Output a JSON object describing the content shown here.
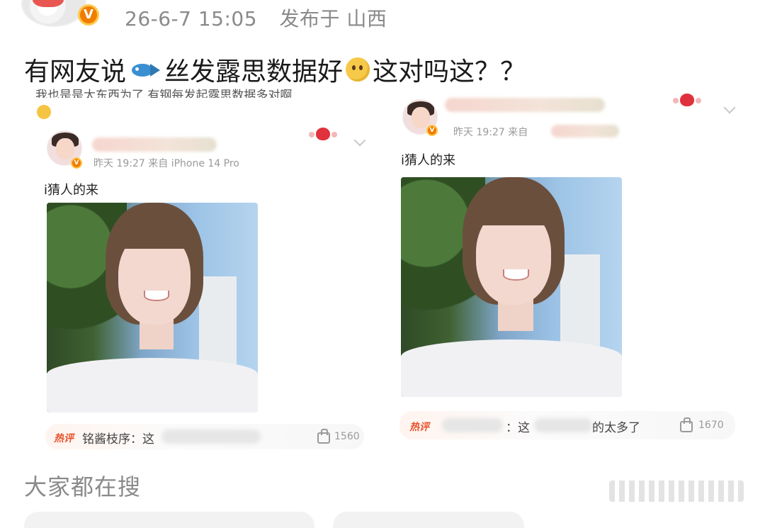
{
  "header": {
    "date": "26-6-7 15:05",
    "location": "发布于 山西",
    "verified_badge": "V"
  },
  "post": {
    "text_part1": "有网友说",
    "emoji1": "fish-icon",
    "text_part2": "丝发露思数据好",
    "emoji2": "thinking-face-icon",
    "text_part3": "这对吗这？？"
  },
  "screenshot_left": {
    "cut_text": "我也是是太东西为了 有钢每发起露思数据多对啊",
    "meta": "昨天 19:27  来自 iPhone 14 Pro",
    "content": "i猜人的来",
    "hot_label": "热评",
    "hot_text": "铭酱枝序：这",
    "likes": "1560"
  },
  "screenshot_right": {
    "meta": "昨天 19:27  来自",
    "content": "i猜人的来",
    "hot_label": "热评",
    "hot_text_prefix": "：这",
    "hot_text_suffix": "的太多了",
    "likes": "1670"
  },
  "section": {
    "title": "大家都在搜"
  },
  "colors": {
    "accent_orange": "#f07d00",
    "hot_red": "#e8542d",
    "meta_gray": "#8a8a8a"
  }
}
